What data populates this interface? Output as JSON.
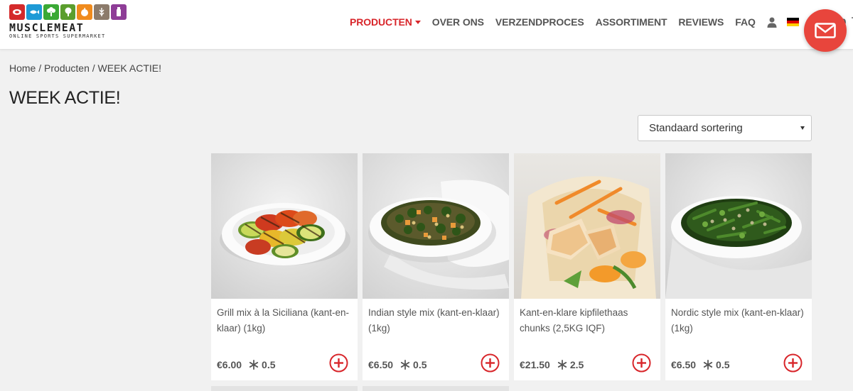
{
  "brand": {
    "name": "MUSCLEMEAT",
    "tagline": "ONLINE SPORTS SUPERMARKET",
    "icon_colors": [
      "#d42a2b",
      "#1e9ad6",
      "#3aa935",
      "#5b9e2d",
      "#f08b1d",
      "#8c7b6b",
      "#8e3d97"
    ]
  },
  "nav": {
    "items": [
      {
        "label": "PRODUCTEN",
        "active": true
      },
      {
        "label": "OVER ONS"
      },
      {
        "label": "VERZENDPROCES"
      },
      {
        "label": "ASSORTIMENT"
      },
      {
        "label": "REVIEWS"
      },
      {
        "label": "FAQ"
      }
    ],
    "freezer_count": "0",
    "cart_count": "0"
  },
  "colors": {
    "accent": "#d8262b",
    "fab": "#e8453c"
  },
  "breadcrumb": {
    "home": "Home",
    "sep": " / ",
    "products": "Producten",
    "current": "WEEK ACTIE!"
  },
  "page_title": "WEEK ACTIE!",
  "sort": {
    "selected": "Standaard sortering"
  },
  "products": [
    {
      "name": "Grill mix à la Siciliana (kant-en-klaar) (1kg)",
      "price": "€6.00",
      "freeze": "0.5",
      "image": "grilled-vegetables-plate"
    },
    {
      "name": "Indian style mix (kant-en-klaar) (1kg)",
      "price": "€6.50",
      "freeze": "0.5",
      "image": "lentil-spinach-plate"
    },
    {
      "name": "Kant-en-klare kipfilethaas chunks (2,5KG IQF)",
      "price": "€21.50",
      "freeze": "2.5",
      "image": "chicken-wrap"
    },
    {
      "name": "Nordic style mix (kant-en-klaar) (1kg)",
      "price": "€6.50",
      "freeze": "0.5",
      "image": "green-beans-plate"
    }
  ]
}
